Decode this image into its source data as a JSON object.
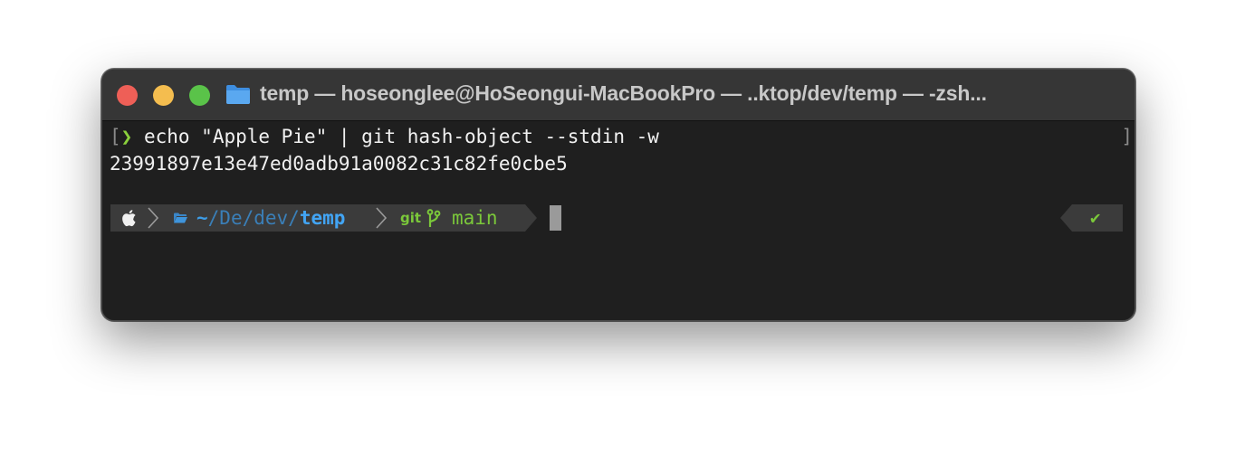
{
  "window": {
    "title": "temp — hoseonglee@HoSeongui-MacBookPro — ..ktop/dev/temp — -zsh..."
  },
  "terminal": {
    "prompt_symbol": "❯",
    "command": "echo \"Apple Pie\" | git hash-object --stdin -w",
    "output": "23991897e13e47ed0adb91a0082c31c82fe0cbe5",
    "left_bracket": "[",
    "right_bracket": "]"
  },
  "powerline": {
    "path_tilde": "~",
    "path_dim": "/De/dev/",
    "path_current": "temp",
    "git_label": "git",
    "branch": "main",
    "status_check": "✔"
  },
  "icons": {
    "os": "apple-icon",
    "folder": "folder-icon",
    "branch": "git-branch-icon",
    "status": "check-icon"
  },
  "colors": {
    "close": "#ee5f57",
    "minimize": "#f4bd4f",
    "zoom": "#5ac349",
    "git_green": "#7bc83a",
    "path_blue": "#42a5f5",
    "terminal_bg": "#1f1f1f",
    "segment_bg": "#3b3b3b"
  }
}
